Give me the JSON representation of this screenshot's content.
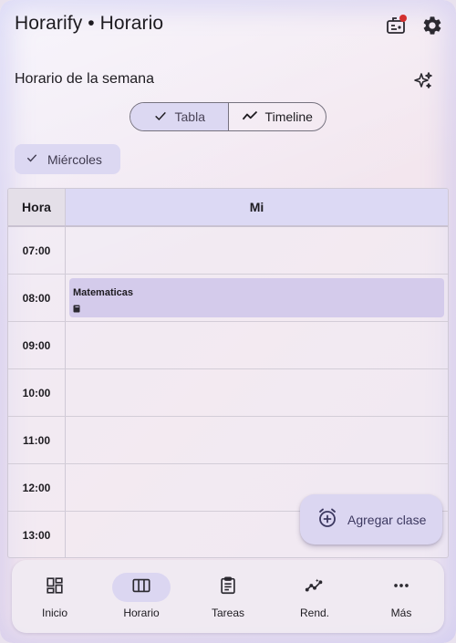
{
  "app": {
    "title": "Horarify • Horario"
  },
  "header": {
    "icons": [
      "notifications-badge-icon",
      "settings-gear-icon"
    ],
    "notification_dot_color": "#d32f2f"
  },
  "section": {
    "title": "Horario de la semana",
    "action_icon": "sparkle-icon"
  },
  "view_toggle": {
    "options": [
      {
        "label": "Tabla",
        "selected": true,
        "icon": "check-icon"
      },
      {
        "label": "Timeline",
        "selected": false,
        "icon": "timeline-icon"
      }
    ]
  },
  "day_filter": {
    "label": "Miércoles",
    "selected": true
  },
  "table": {
    "hour_header": "Hora",
    "day_header": "Mi",
    "rows": [
      {
        "time": "07:00",
        "event": null
      },
      {
        "time": "08:00",
        "event": "Matematicas"
      },
      {
        "time": "09:00",
        "event": null
      },
      {
        "time": "10:00",
        "event": null
      },
      {
        "time": "11:00",
        "event": null
      },
      {
        "time": "12:00",
        "event": null
      },
      {
        "time": "13:00",
        "event": null
      }
    ]
  },
  "fab": {
    "label": "Agregar clase",
    "icon": "alarm-add-icon"
  },
  "bottom_nav": {
    "items": [
      {
        "label": "Inicio",
        "icon": "dashboard-icon",
        "active": false
      },
      {
        "label": "Horario",
        "icon": "view-week-icon",
        "active": true
      },
      {
        "label": "Tareas",
        "icon": "clipboard-icon",
        "active": false
      },
      {
        "label": "Rend.",
        "icon": "insights-icon",
        "active": false
      },
      {
        "label": "Más",
        "icon": "more-horiz-icon",
        "active": false
      }
    ]
  },
  "colors": {
    "accent_container": "#dcd8f2",
    "event_block": "#d4cbeb",
    "text": "#1d1b20"
  }
}
